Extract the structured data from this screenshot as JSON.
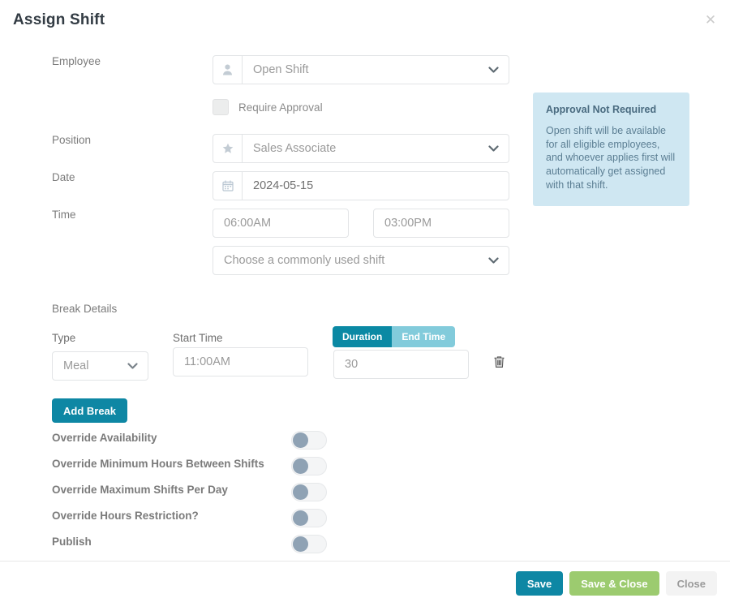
{
  "modal": {
    "title": "Assign Shift",
    "close_icon": "close-icon"
  },
  "form": {
    "employee": {
      "label": "Employee",
      "icon": "user-icon",
      "value": "Open Shift",
      "chevron": "chevron-down-icon"
    },
    "require_approval": {
      "label": "Require Approval",
      "checked": false
    },
    "position": {
      "label": "Position",
      "icon": "star-icon",
      "value": "Sales Associate",
      "chevron": "chevron-down-icon"
    },
    "date": {
      "label": "Date",
      "icon": "calendar-icon",
      "value": "2024-05-15"
    },
    "time": {
      "label": "Time",
      "start": "06:00AM",
      "end": "03:00PM"
    },
    "common_shift": {
      "placeholder": "Choose a commonly used shift",
      "chevron": "chevron-down-icon"
    }
  },
  "info_panel": {
    "title": "Approval Not Required",
    "body": "Open shift will be available for all eligible employees, and whoever applies first will automatically get assigned with that shift."
  },
  "break_details": {
    "section_title": "Break Details",
    "columns": {
      "type": "Type",
      "start_time": "Start Time"
    },
    "segmented": {
      "duration": "Duration",
      "end_time": "End Time",
      "active": "Duration"
    },
    "row": {
      "type_value": "Meal",
      "start_time_value": "11:00AM",
      "duration_value": "30",
      "delete_icon": "trash-icon"
    },
    "add_break_label": "Add Break"
  },
  "toggles": [
    {
      "label": "Override Availability",
      "on": false
    },
    {
      "label": "Override Minimum Hours Between Shifts",
      "on": false
    },
    {
      "label": "Override Maximum Shifts Per Day",
      "on": false
    },
    {
      "label": "Override Hours Restriction?",
      "on": false
    },
    {
      "label": "Publish",
      "on": false
    }
  ],
  "footer": {
    "save": "Save",
    "save_and_close": "Save & Close",
    "close": "Close"
  },
  "colors": {
    "teal": "#0e87a4",
    "teal_dark": "#0b89a4",
    "teal_light": "#82cbdb",
    "green": "#9ccb6f",
    "gray_button": "#f3f3f3",
    "info_bg": "#cfe7f2",
    "info_title": "#4a6b80",
    "info_text": "#5b7e93",
    "toggle_knob": "#8fa2b4",
    "label": "#7b7b7b"
  }
}
